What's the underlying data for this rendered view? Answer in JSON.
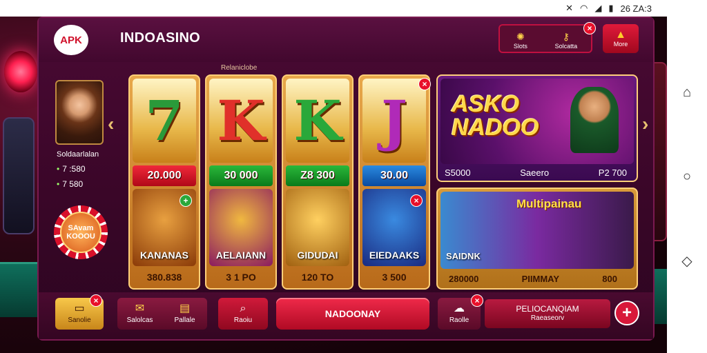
{
  "status_bar": {
    "time": "26 ZA:3"
  },
  "header": {
    "logo": "APK",
    "title": "INDOASINO",
    "tabs": [
      {
        "label": "Slots",
        "icon": "settings-icon"
      },
      {
        "label": "Solcatta",
        "icon": "key-icon"
      }
    ],
    "more_label": "More"
  },
  "subtitle": "Relaniclobe",
  "profile": {
    "name": "Soldaarlalan",
    "stat1": "7 :580",
    "stat2": "7 580",
    "chip_text": "SAvam KOOOU"
  },
  "slots": [
    {
      "symbol": "7",
      "amount": "20.000",
      "game": "KANANAS",
      "footer": "380.838"
    },
    {
      "symbol": "K",
      "amount": "30 000",
      "game": "AELAIANN",
      "footer": "3 1 PO"
    },
    {
      "symbol": "K",
      "amount": "Z8 300",
      "game": "GIDUDAI",
      "footer": "120 TO"
    },
    {
      "symbol": "J",
      "amount": "30.00",
      "game": "EIEDAAKS",
      "footer": "3 500"
    }
  ],
  "promo": {
    "title": "ASKO NADOO",
    "stats": [
      "S5000",
      "Saeero",
      "P2 700"
    ]
  },
  "multi": {
    "title": "Multipainau",
    "left_label": "SAIDNK",
    "stats": [
      "280000",
      "PIIMMAY",
      "800"
    ]
  },
  "bottom": {
    "b1": "Sanolie",
    "b2": "Salolcas",
    "b3": "Pallale",
    "b4": "Raoiu",
    "main": "NADOONAY",
    "b5": "Raolle",
    "wide_title": "PELIOCANQIAM",
    "wide_sub": "Raeaseorv"
  },
  "colors": {
    "accent": "#e0103a",
    "gold": "#ffd07a",
    "bg": "#3a0628"
  }
}
